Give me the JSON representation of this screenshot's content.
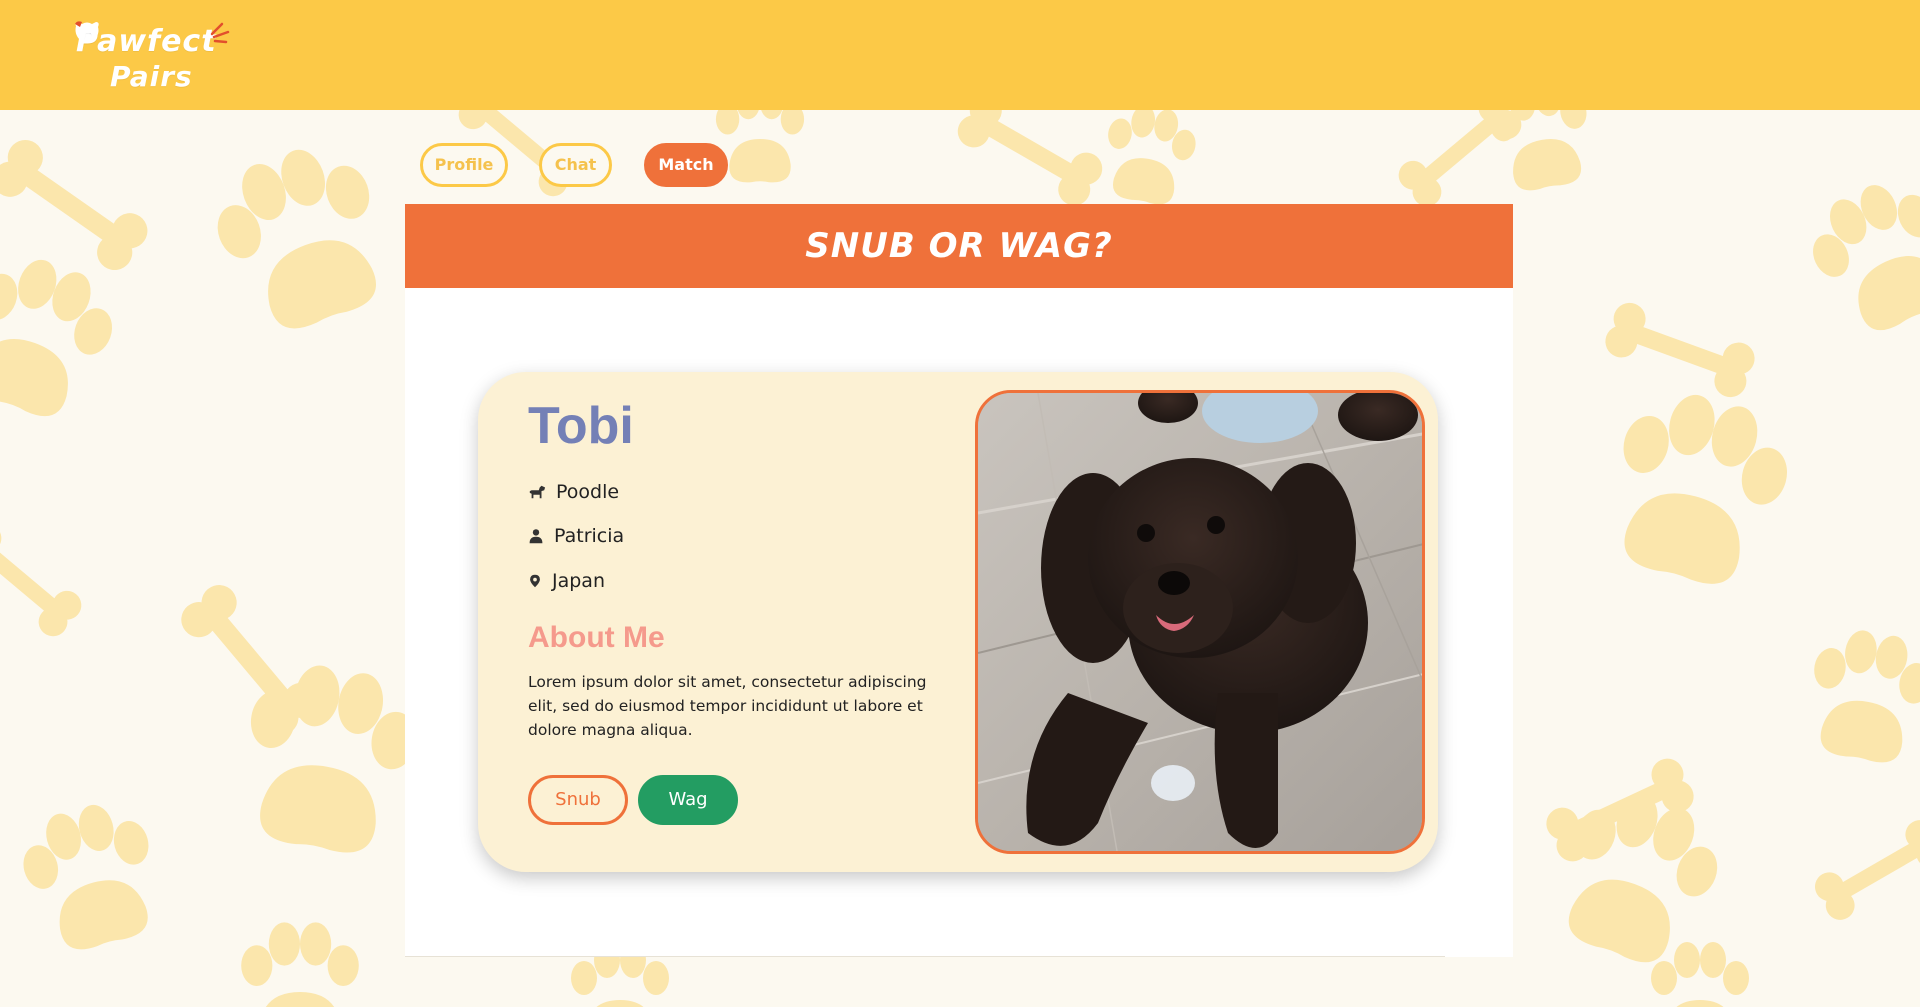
{
  "app": {
    "logo": {
      "line1": "Pawfect",
      "line2": "Pairs"
    }
  },
  "colors": {
    "header_bg": "#fcc947",
    "accent": "#ef713a",
    "name_color": "#7480b6",
    "about_color": "#f59a8c",
    "wag_color": "#239d62",
    "card_bg": "#fcf1d4",
    "pattern_color": "#fbe6ac"
  },
  "nav": {
    "tabs": [
      {
        "label": "Profile",
        "active": false
      },
      {
        "label": "Chat",
        "active": false
      },
      {
        "label": "Match",
        "active": true
      }
    ]
  },
  "panel": {
    "title": "Snub or Wag?"
  },
  "profile": {
    "name": "Tobi",
    "breed": {
      "icon": "dog-icon",
      "value": "Poodle"
    },
    "owner": {
      "icon": "user-icon",
      "value": "Patricia"
    },
    "location": {
      "icon": "map-pin-icon",
      "value": "Japan"
    },
    "about_title": "About Me",
    "about_text": "Lorem ipsum dolor sit amet, consectetur adipiscing elit, sed do eiusmod tempor incididunt ut labore et dolore magna aliqua.",
    "photo": {
      "subject": "dark brown poodle lying on a wooden floor"
    },
    "actions": {
      "snub": "Snub",
      "wag": "Wag"
    }
  }
}
